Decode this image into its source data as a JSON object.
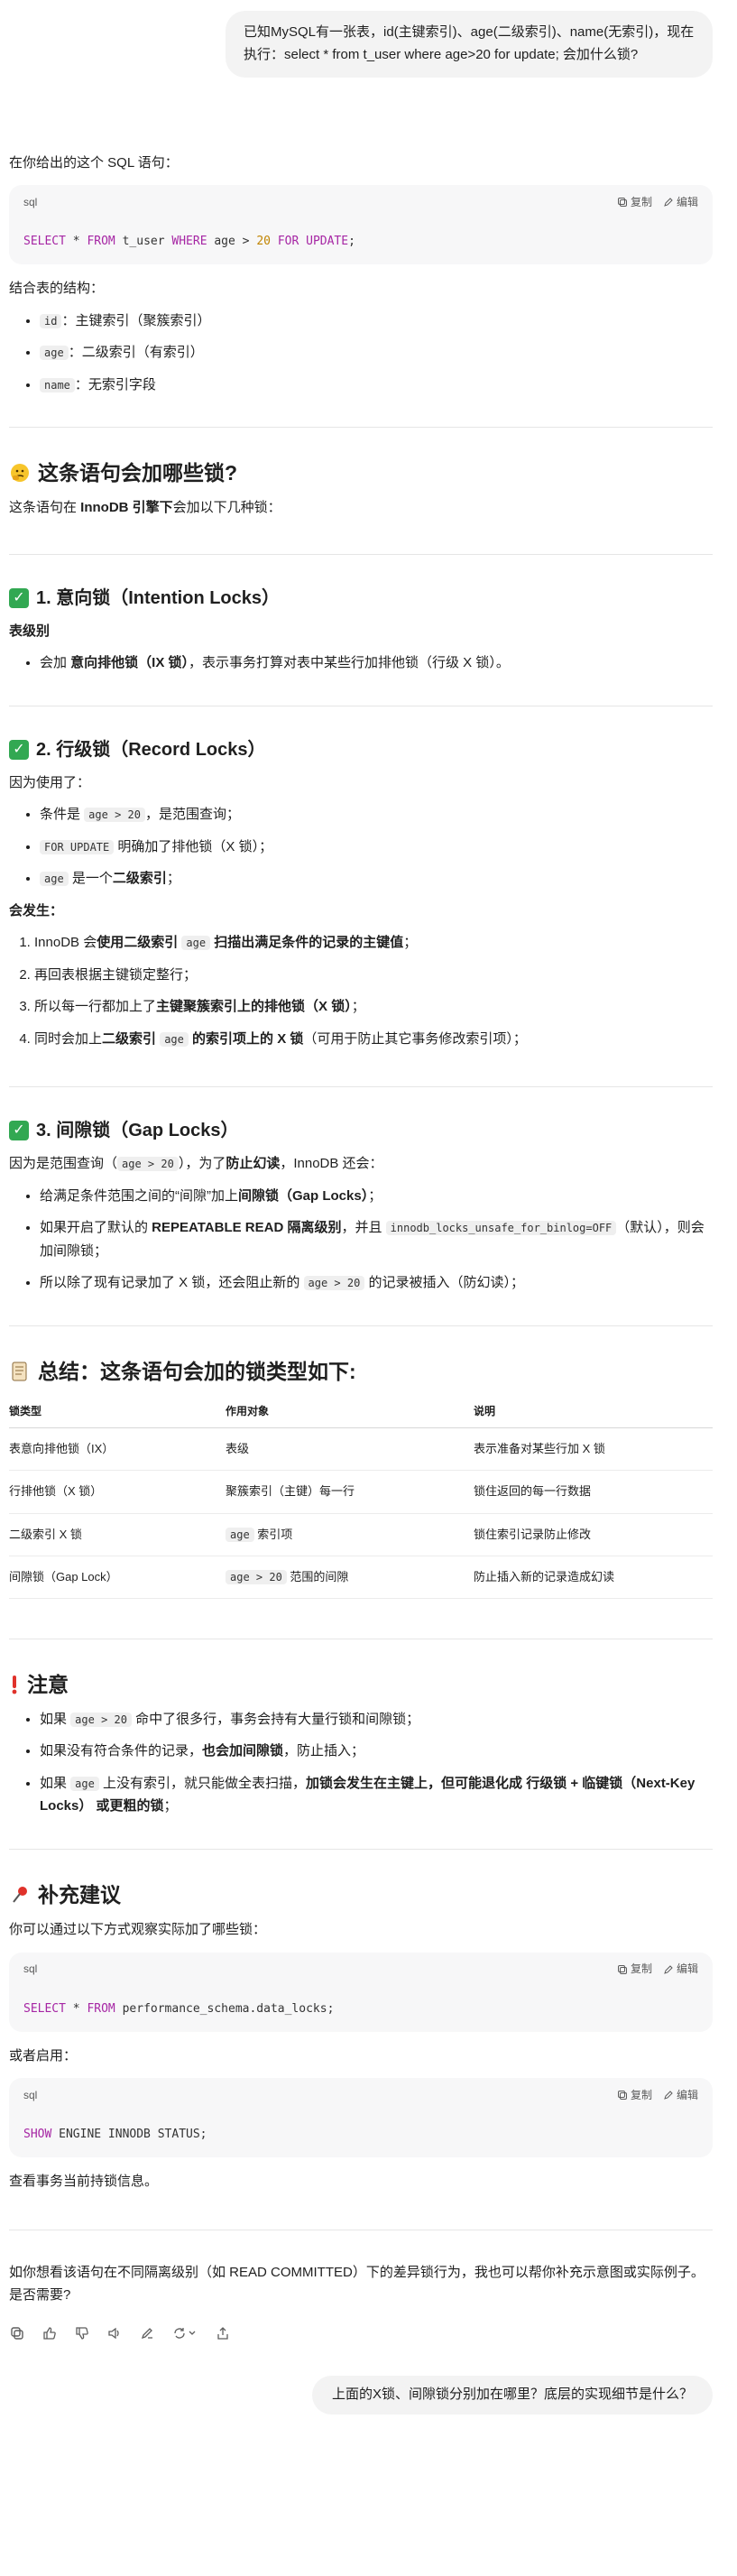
{
  "user_message_1": "已知MySQL有一张表，id(主键索引)、age(二级索引)、name(无索引)，现在执行：select * from t_user where age>20 for update; 会加什么锁?",
  "intro": "在你给出的这个 SQL 语句：",
  "code_copy": "复制",
  "code_edit": "编辑",
  "code1": {
    "lang": "sql",
    "p1": "SELECT",
    "p2": " * ",
    "p3": "FROM",
    "p4": " t_user ",
    "p5": "WHERE",
    "p6": " age > ",
    "p7": "20",
    "p8": " ",
    "p9": "FOR UPDATE",
    "p10": ";"
  },
  "structure_intro": "结合表的结构：",
  "structure": [
    {
      "code": "id",
      "text": "：主键索引（聚簇索引）"
    },
    {
      "code": "age",
      "text": "：二级索引（有索引）"
    },
    {
      "code": "name",
      "text": "：无索引字段"
    }
  ],
  "section_locks": {
    "title": "这条语句会加哪些锁?",
    "intro_a": "这条语句在 ",
    "intro_b": "InnoDB 引擎下",
    "intro_c": "会加以下几种锁："
  },
  "s1": {
    "title": "1. 意向锁（Intention Locks）",
    "level": "表级别",
    "item_a": "会加 ",
    "item_b": "意向排他锁（IX 锁）",
    "item_c": "，表示事务打算对表中某些行加排他锁（行级 X 锁）。"
  },
  "s2": {
    "title": "2. 行级锁（Record Locks）",
    "because": "因为使用了：",
    "b1_a": "条件是 ",
    "b1_code": "age > 20",
    "b1_b": "，是范围查询；",
    "b2_code": "FOR UPDATE",
    "b2_b": " 明确加了排他锁（X 锁）；",
    "b3_code": "age",
    "b3_a": " 是一个",
    "b3_b": "二级索引",
    "b3_c": "；",
    "happen": "会发生：",
    "o1_a": "InnoDB 会",
    "o1_b": "使用二级索引 ",
    "o1_code": "age",
    "o1_c": " 扫描出满足条件的记录的主键值",
    "o1_d": "；",
    "o2": "再回表根据主键锁定整行；",
    "o3_a": "所以每一行都加上了",
    "o3_b": "主键聚簇索引上的排他锁（X 锁）",
    "o3_c": "；",
    "o4_a": "同时会加上",
    "o4_b": "二级索引 ",
    "o4_code": "age",
    "o4_c": " 的索引项上的 X 锁",
    "o4_d": "（可用于防止其它事务修改索引项）；"
  },
  "s3": {
    "title": "3. 间隙锁（Gap Locks）",
    "intro_a": "因为是范围查询（",
    "intro_code": "age > 20",
    "intro_b": "），为了",
    "intro_c": "防止幻读",
    "intro_d": "，InnoDB 还会：",
    "b1_a": "给满足条件范围之间的“间隙”加上",
    "b1_b": "间隙锁（Gap Locks）",
    "b1_c": "；",
    "b2_a": "如果开启了默认的 ",
    "b2_b": "REPEATABLE READ 隔离级别",
    "b2_c": "，并且 ",
    "b2_code": "innodb_locks_unsafe_for_binlog=OFF",
    "b2_d": "（默认），则会加间隙锁；",
    "b3_a": "所以除了现有记录加了 X 锁，还会阻止新的 ",
    "b3_code": "age > 20",
    "b3_b": " 的记录被插入（防幻读）；"
  },
  "summary": {
    "title": "总结：这条语句会加的锁类型如下:",
    "headers": [
      "锁类型",
      "作用对象",
      "说明"
    ],
    "rows": [
      [
        "表意向排他锁（IX）",
        "表级",
        "",
        "表示准备对某些行加 X 锁"
      ],
      [
        "行排他锁（X 锁）",
        "聚簇索引（主键）每一行",
        "",
        "锁住返回的每一行数据"
      ],
      [
        "二级索引 X 锁",
        "",
        "age",
        "锁住索引记录防止修改",
        " 索引项"
      ],
      [
        "间隙锁（Gap Lock）",
        "",
        "age > 20",
        "防止插入新的记录造成幻读",
        " 范围的间隙"
      ]
    ]
  },
  "note": {
    "title": "注意",
    "b1_a": "如果 ",
    "b1_code": "age > 20",
    "b1_b": " 命中了很多行，事务会持有大量行锁和间隙锁；",
    "b2_a": "如果没有符合条件的记录，",
    "b2_b": "也会加间隙锁",
    "b2_c": "，防止插入；",
    "b3_a": "如果 ",
    "b3_code": "age",
    "b3_b": " 上没有索引，就只能做全表扫描，",
    "b3_c": "加锁会发生在主键上，但可能退化成 行级锁 + 临键锁（Next-Key Locks） 或更粗的锁",
    "b3_d": "；"
  },
  "suggest": {
    "title": "补充建议",
    "intro": "你可以通过以下方式观察实际加了哪些锁：",
    "code2": {
      "lang": "sql",
      "p1": "SELECT",
      "p2": " * ",
      "p3": "FROM",
      "p4": " performance_schema.data_locks;"
    },
    "or": "或者启用：",
    "code3": {
      "lang": "sql",
      "p1": "SHOW",
      "p2": " ENGINE INNODB STATUS;"
    },
    "view": "查看事务当前持锁信息。"
  },
  "closing": "如你想看该语句在不同隔离级别（如 READ COMMITTED）下的差异锁行为，我也可以帮你补充示意图或实际例子。是否需要?",
  "user_message_2": "上面的X锁、间隙锁分别加在哪里？底层的实现细节是什么？",
  "icons": [
    "copy-icon",
    "thumbs-up-icon",
    "thumbs-down-icon",
    "speaker-icon",
    "edit-canvas-icon",
    "regenerate-icon",
    "share-icon"
  ]
}
